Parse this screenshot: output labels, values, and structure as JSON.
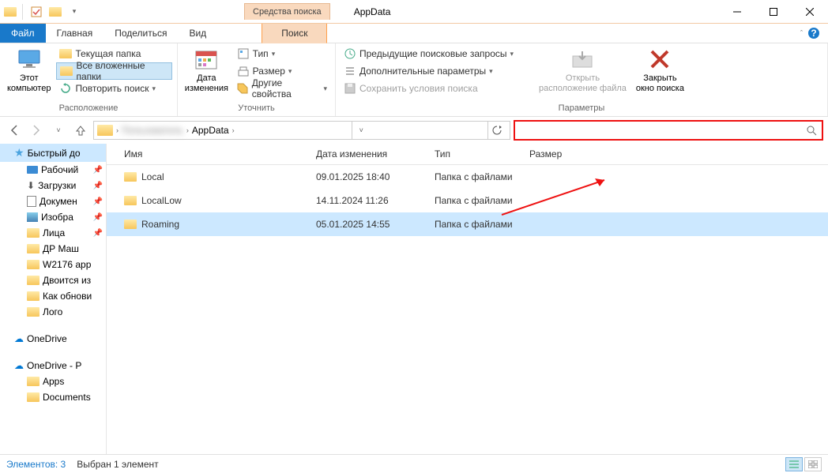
{
  "window": {
    "title": "AppData",
    "context_tab": "Средства поиска"
  },
  "tabs": {
    "file": "Файл",
    "home": "Главная",
    "share": "Поделиться",
    "view": "Вид",
    "search": "Поиск"
  },
  "ribbon": {
    "location": {
      "label": "Расположение",
      "this_pc": "Этот\nкомпьютер",
      "current_folder": "Текущая папка",
      "all_subfolders": "Все вложенные папки",
      "search_again": "Повторить поиск "
    },
    "refine": {
      "label": "Уточнить",
      "date_modified": "Дата\nизменения",
      "type": "Тип ",
      "size": "Размер ",
      "other_props": "Другие свойства "
    },
    "options": {
      "label": "Параметры",
      "recent": "Предыдущие поисковые запросы ",
      "advanced": "Дополнительные параметры ",
      "save": "Сохранить условия поиска",
      "open_loc": "Открыть\nрасположение файла",
      "close": "Закрыть\nокно поиска"
    }
  },
  "breadcrumb": {
    "user": "Пользователь",
    "appdata": "AppData"
  },
  "search": {
    "placeholder": ""
  },
  "columns": {
    "name": "Имя",
    "date": "Дата изменения",
    "type": "Тип",
    "size": "Размер"
  },
  "rows": [
    {
      "name": "Local",
      "date": "09.01.2025 18:40",
      "type": "Папка с файлами",
      "size": ""
    },
    {
      "name": "LocalLow",
      "date": "14.11.2024 11:26",
      "type": "Папка с файлами",
      "size": ""
    },
    {
      "name": "Roaming",
      "date": "05.01.2025 14:55",
      "type": "Папка с файлами",
      "size": ""
    }
  ],
  "sidebar": {
    "quick": "Быстрый до",
    "desktop": "Рабочий",
    "downloads": "Загрузки",
    "documents": "Докумен",
    "pictures": "Изобра",
    "faces": "Лица",
    "dr": "ДР Маш",
    "w2176": "W2176 app",
    "dvoitsa": "Двоится из",
    "howto": "Как обнови",
    "logo": "Лого",
    "onedrive": "OneDrive",
    "onedrive_p": "OneDrive - P",
    "apps": "Apps",
    "documents2": "Documents"
  },
  "status": {
    "count": "Элементов: 3",
    "selected": "Выбран 1 элемент"
  }
}
